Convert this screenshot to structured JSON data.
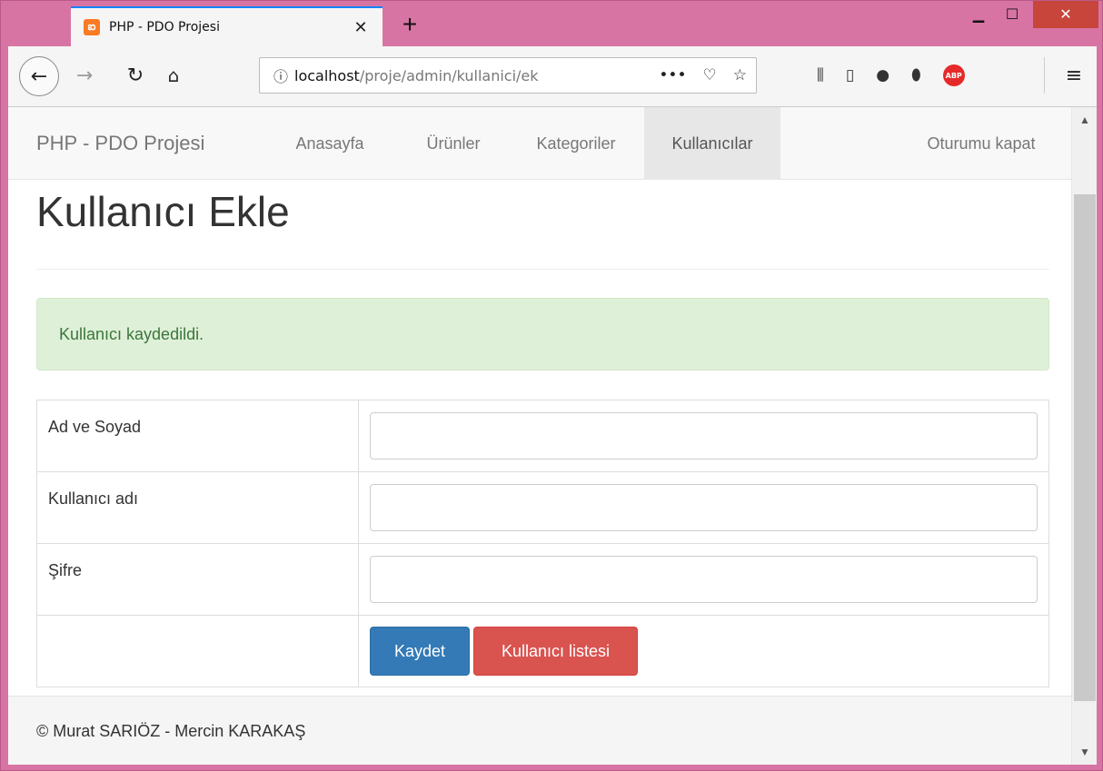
{
  "browser": {
    "tab_title": "PHP - PDO Projesi",
    "tab_favicon": "xampp-icon",
    "url_host": "localhost",
    "url_path": "/proje/admin/kullanici/ek"
  },
  "navbar": {
    "brand": "PHP - PDO Projesi",
    "items": [
      {
        "label": "Anasayfa"
      },
      {
        "label": "Ürünler"
      },
      {
        "label": "Kategoriler"
      },
      {
        "label": "Kullanıcılar",
        "active": true
      }
    ],
    "logout": "Oturumu kapat"
  },
  "page": {
    "title": "Kullanıcı Ekle",
    "alert": "Kullanıcı kaydedildi."
  },
  "form": {
    "fields": [
      {
        "label": "Ad ve Soyad",
        "value": ""
      },
      {
        "label": "Kullanıcı adı",
        "value": ""
      },
      {
        "label": "Şifre",
        "value": ""
      }
    ],
    "save_button": "Kaydet",
    "list_button": "Kullanıcı listesi"
  },
  "footer": {
    "text": "© Murat SARIÖZ - Mercin KARAKAŞ"
  },
  "colors": {
    "window_frame": "#d874a4",
    "active_nav_bg": "#e7e7e7",
    "alert_bg": "#dff0d8",
    "alert_text": "#3c763d",
    "primary": "#337ab7",
    "danger": "#d9534f"
  }
}
